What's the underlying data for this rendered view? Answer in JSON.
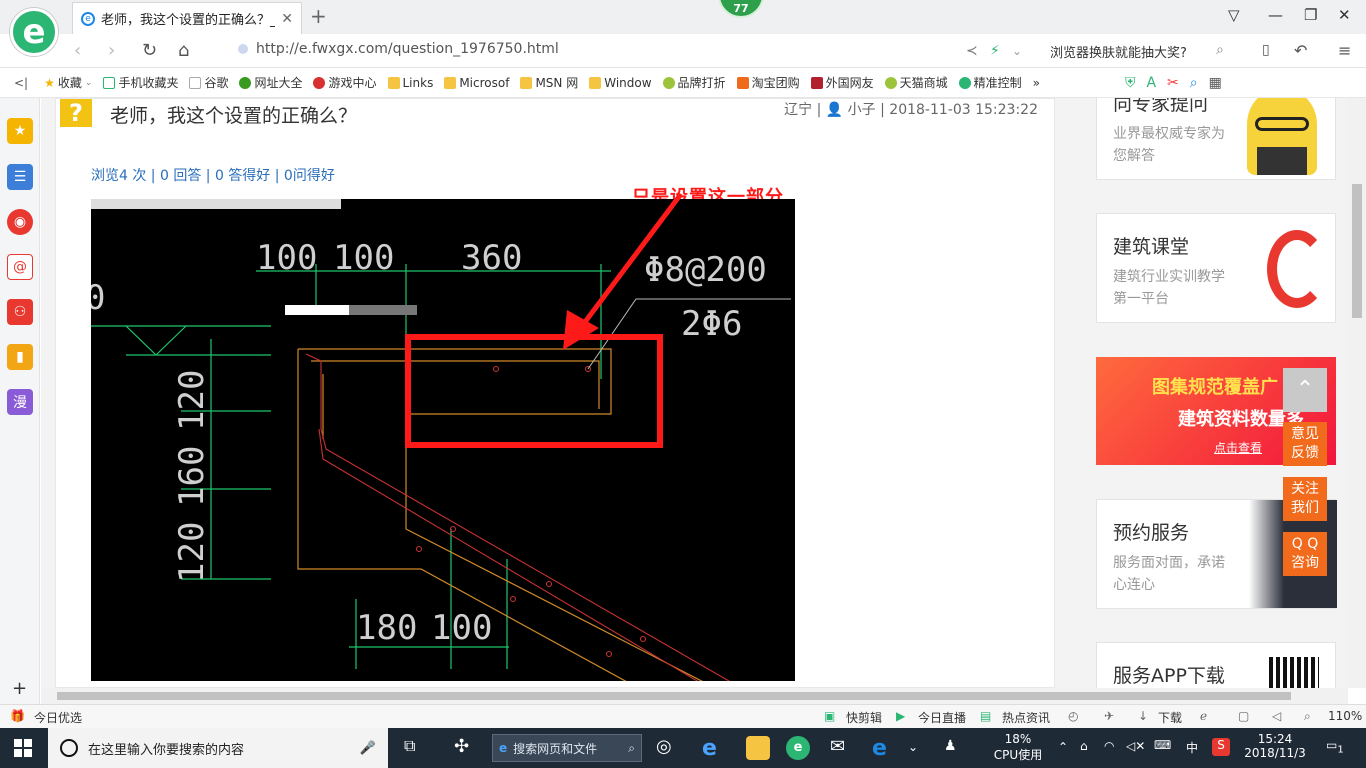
{
  "browser": {
    "tab_title": "老师，我这个设置的正确么？_广",
    "tab_close": "✕",
    "new_tab": "+",
    "badge": "77",
    "url": "http://e.fwxgx.com/question_1976750.html",
    "search_hint": "浏览器换肤就能抽大奖?",
    "bookmarks": [
      "收藏",
      "手机收藏夹",
      "谷歌",
      "网址大全",
      "游戏中心",
      "Links",
      "Microsof",
      "MSN 网",
      "Window",
      "品牌打折",
      "淘宝团购",
      "外国网友",
      "天猫商城",
      "精准控制"
    ],
    "bookmark_more": "»"
  },
  "sidebar": {
    "items": [
      "star-icon",
      "news-icon",
      "weibo-icon",
      "mail-icon",
      "game-icon",
      "book-icon",
      "comic-icon"
    ],
    "comic_label": "漫",
    "add": "+"
  },
  "question": {
    "title": "老师，我这个设置的正确么？",
    "location": "辽宁",
    "user": "小子",
    "datetime": "2018-11-03 15:23:22",
    "stats": "浏览4 次 | 0 回答 | 0 答得好 | 0问得好",
    "annotation": "只是设置这一部分"
  },
  "cad": {
    "dims_top": [
      "100",
      "100",
      "360"
    ],
    "dims_left": [
      "120",
      "160",
      "120"
    ],
    "dims_bottom": [
      "180",
      "100"
    ],
    "rebar_1": "Φ8@200",
    "rebar_2": "2Φ6",
    "left_edge_label": "0"
  },
  "right_panel": {
    "card1_title": "向专家提问",
    "card1_sub": "业界最权威专家为您解答",
    "card2_title": "建筑课堂",
    "card2_sub": "建筑行业实训教学第一平台",
    "banner_line1": "图集规范覆盖广",
    "banner_line2": "建筑资料数量多",
    "banner_cta": "点击查看",
    "card3_title": "预约服务",
    "card3_sub": "服务面对面，承诺心连心",
    "card4_title": "服务APP下载"
  },
  "float_buttons": [
    "意见\n反馈",
    "关注\n我们",
    "Q Q\n咨询"
  ],
  "statusbar": {
    "today": "今日优选",
    "kuaijianji": "快剪辑",
    "live": "今日直播",
    "hot": "热点资讯",
    "download": "下载",
    "zoom": "110%"
  },
  "taskbar": {
    "search_placeholder": "在这里输入你要搜索的内容",
    "web_search": "搜索网页和文件",
    "cpu_percent": "18%",
    "cpu_label": "CPU使用",
    "ime": "中",
    "time": "15:24",
    "date": "2018/11/3",
    "notif_count": "1"
  },
  "colors": {
    "accent_green": "#2bb673",
    "link_blue": "#2a6ebb",
    "orange": "#f26a1b",
    "annotation_red": "#ff1a1a"
  }
}
